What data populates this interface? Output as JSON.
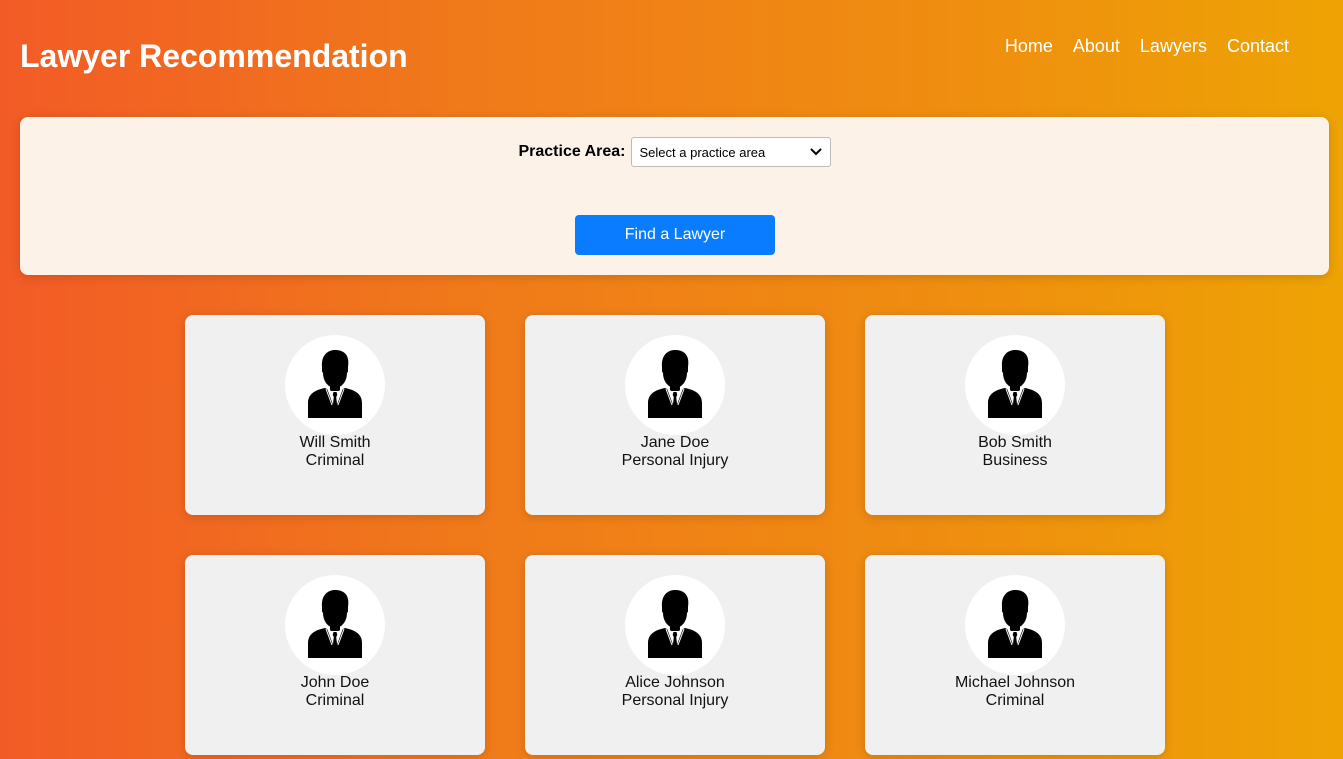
{
  "header": {
    "title": "Lawyer Recommendation",
    "nav": [
      "Home",
      "About",
      "Lawyers",
      "Contact"
    ]
  },
  "search": {
    "practice_label": "Practice Area:",
    "practice_selected": "Select a practice area",
    "button_label": "Find a Lawyer"
  },
  "lawyers": [
    {
      "name": "Will Smith",
      "area": "Criminal"
    },
    {
      "name": "Jane Doe",
      "area": "Personal Injury"
    },
    {
      "name": "Bob Smith",
      "area": "Business"
    },
    {
      "name": "John Doe",
      "area": "Criminal"
    },
    {
      "name": "Alice Johnson",
      "area": "Personal Injury"
    },
    {
      "name": "Michael Johnson",
      "area": "Criminal"
    }
  ],
  "icons": {
    "avatar": "businessman-avatar-icon",
    "select_arrow": "chevron-down-icon"
  },
  "colors": {
    "gradient_start": "#f25b26",
    "gradient_end": "#eea304",
    "panel": "#fdf2e8",
    "button": "#0a7cff",
    "card": "#f0f0f0"
  }
}
